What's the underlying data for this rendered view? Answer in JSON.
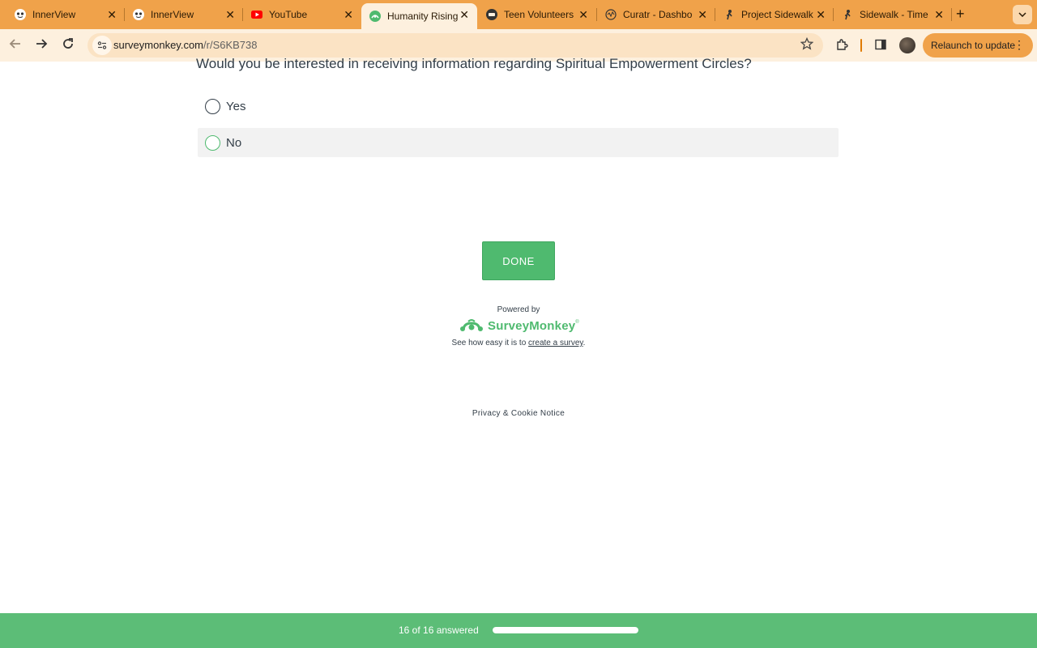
{
  "browser": {
    "tabs": [
      {
        "title": "InnerView",
        "icon": "innerview-icon",
        "active": false
      },
      {
        "title": "InnerView",
        "icon": "innerview-icon",
        "active": false
      },
      {
        "title": "YouTube",
        "icon": "youtube-icon",
        "active": false
      },
      {
        "title": "Humanity Rising",
        "icon": "surveymonkey-icon",
        "active": true
      },
      {
        "title": "Teen Volunteers",
        "icon": "teen-volunteers-icon",
        "active": false
      },
      {
        "title": "Curatr - Dashbo",
        "icon": "curatr-icon",
        "active": false
      },
      {
        "title": "Project Sidewalk",
        "icon": "project-sidewalk-icon",
        "active": false
      },
      {
        "title": "Sidewalk - Time",
        "icon": "sidewalk-icon",
        "active": false
      }
    ],
    "new_tab_symbol": "+",
    "close_symbol": "✕",
    "address": {
      "domain": "surveymonkey.com",
      "path": "/r/S6KB738"
    },
    "relaunch_label": "Relaunch to update",
    "accent_color": "#f0a24a"
  },
  "survey": {
    "question": "Would you be interested in receiving information regarding Spiritual Empowerment Circles?",
    "options": [
      {
        "label": "Yes",
        "selected": false
      },
      {
        "label": "No",
        "selected": false
      }
    ],
    "done_label": "DONE",
    "powered_by": "Powered by",
    "brand_name": "SurveyMonkey",
    "see_how_prefix": "See how easy it is to",
    "see_how_link": "create a survey",
    "see_how_suffix": ".",
    "privacy_link": "Privacy & Cookie Notice",
    "brand_color": "#4fba6f"
  },
  "progress": {
    "text": "16 of 16 answered",
    "answered": 16,
    "total": 16,
    "fraction": 1.0
  }
}
